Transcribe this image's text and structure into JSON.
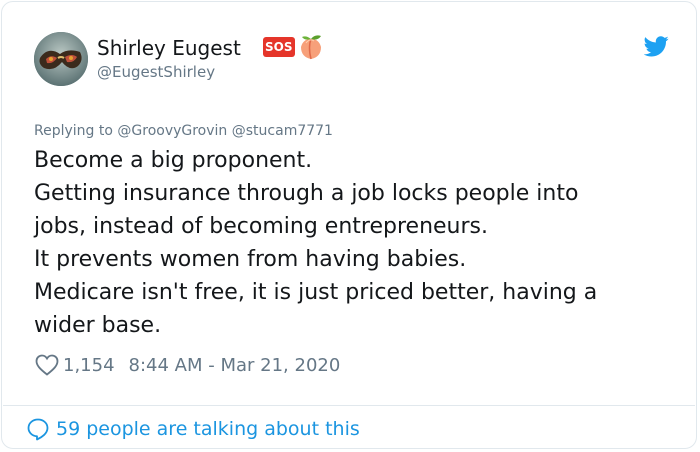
{
  "tweet": {
    "author": {
      "display_name": "Shirley Eugest",
      "handle": "@EugestShirley",
      "emoji_badges": [
        "SOS",
        "peach"
      ],
      "avatar_icon": "sunglasses-avatar"
    },
    "replying_to": {
      "prefix": "Replying to",
      "mentions": [
        "@GroovyGrovin",
        "@stucam7771"
      ]
    },
    "text_lines": [
      "Become a big proponent.",
      "Getting insurance through a job locks people into",
      "jobs, instead of becoming entrepreneurs.",
      "It prevents women from having babies.",
      "Medicare isn't free, it is just priced better, having a",
      "wider base."
    ],
    "likes": "1,154",
    "timestamp": "8:44 AM - Mar 21, 2020",
    "talking_about": "59 people are talking about this",
    "icons": {
      "brand": "twitter-bird-icon",
      "like": "heart-icon",
      "conversation": "speech-bubble-icon"
    },
    "colors": {
      "twitter_blue": "#1da1f2",
      "link_blue": "#1b95e0",
      "secondary_text": "#657786",
      "primary_text": "#14171a",
      "border": "#e1e8ed",
      "sos_red": "#e5352a"
    }
  }
}
